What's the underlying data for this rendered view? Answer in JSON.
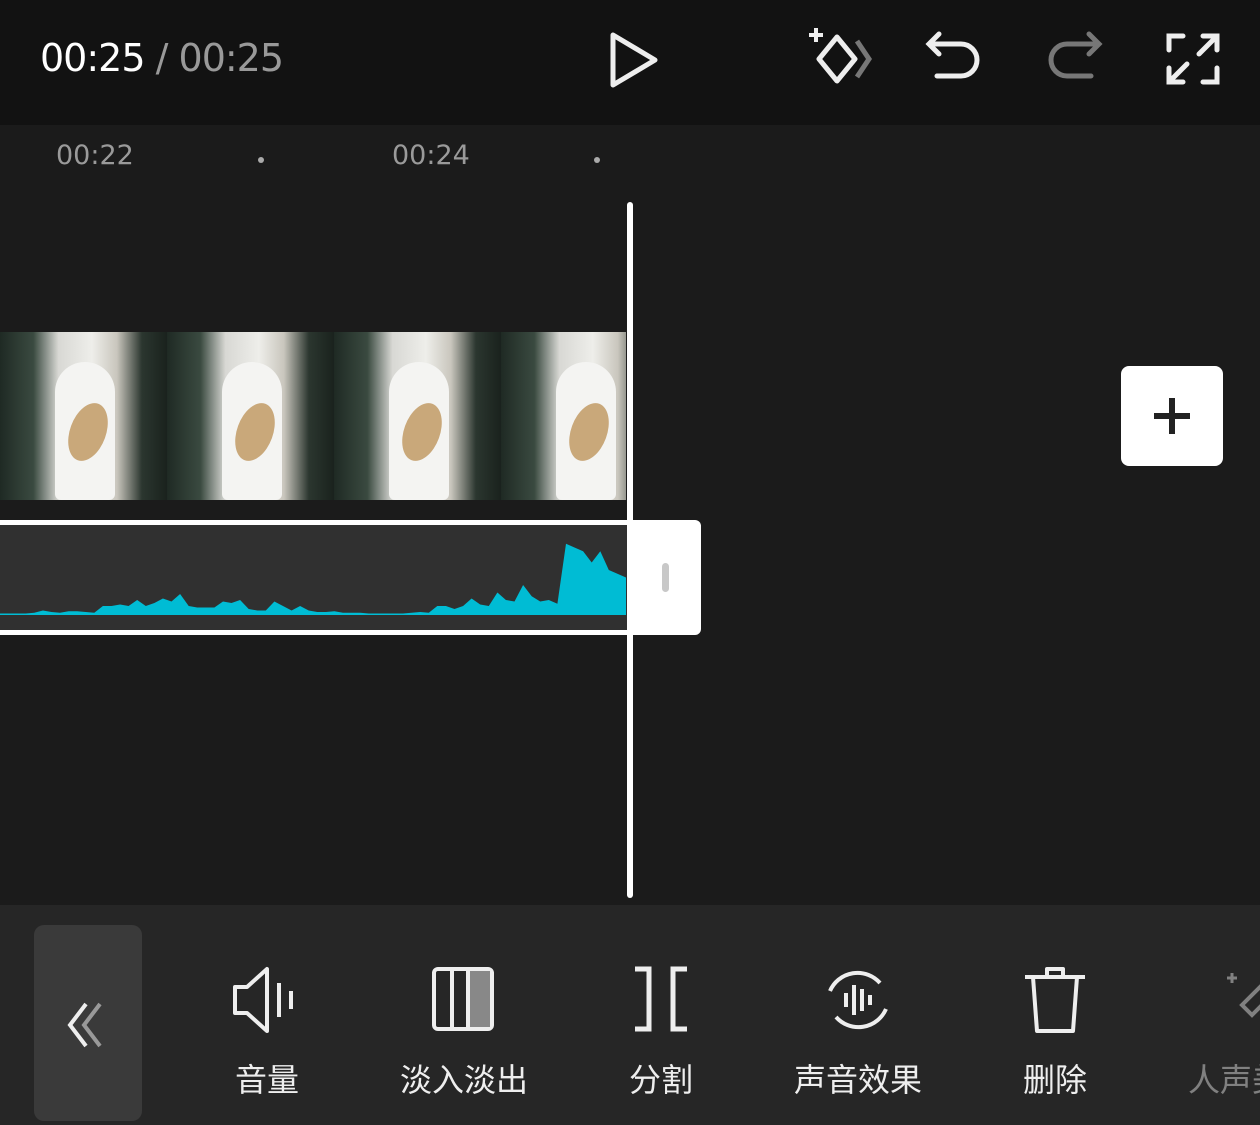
{
  "header": {
    "current_time": "00:25",
    "separator": "/",
    "total_time": "00:25"
  },
  "icons": {
    "play": "play-icon",
    "keyframe": "add-keyframe-icon",
    "undo": "undo-icon",
    "redo": "redo-icon",
    "fullscreen": "fullscreen-icon"
  },
  "ruler": {
    "labels": [
      "00:22",
      "00:24"
    ]
  },
  "colors": {
    "waveform": "#00bcd4",
    "top_bar": "#121212",
    "timeline": "#1b1b1b",
    "toolbar": "#262626"
  },
  "waveform_levels": [
    0.02,
    0.02,
    0.02,
    0.02,
    0.03,
    0.06,
    0.04,
    0.03,
    0.05,
    0.05,
    0.04,
    0.03,
    0.12,
    0.12,
    0.14,
    0.12,
    0.2,
    0.12,
    0.16,
    0.22,
    0.18,
    0.28,
    0.12,
    0.1,
    0.1,
    0.1,
    0.18,
    0.16,
    0.2,
    0.08,
    0.06,
    0.06,
    0.18,
    0.12,
    0.06,
    0.12,
    0.06,
    0.04,
    0.04,
    0.05,
    0.03,
    0.03,
    0.03,
    0.02,
    0.02,
    0.02,
    0.02,
    0.02,
    0.03,
    0.04,
    0.03,
    0.12,
    0.12,
    0.08,
    0.12,
    0.22,
    0.14,
    0.12,
    0.3,
    0.2,
    0.18,
    0.4,
    0.25,
    0.18,
    0.2,
    0.15,
    0.95,
    0.9,
    0.85,
    0.7,
    0.85,
    0.6,
    0.55,
    0.5
  ],
  "toolbar": {
    "collapse": "collapse-icon",
    "items": [
      {
        "label": "音量",
        "icon": "volume-icon"
      },
      {
        "label": "淡入淡出",
        "icon": "fade-icon"
      },
      {
        "label": "分割",
        "icon": "split-icon"
      },
      {
        "label": "声音效果",
        "icon": "sound-effect-icon"
      },
      {
        "label": "删除",
        "icon": "delete-icon"
      },
      {
        "label": "人声美化",
        "icon": "voice-enhance-icon"
      }
    ]
  }
}
